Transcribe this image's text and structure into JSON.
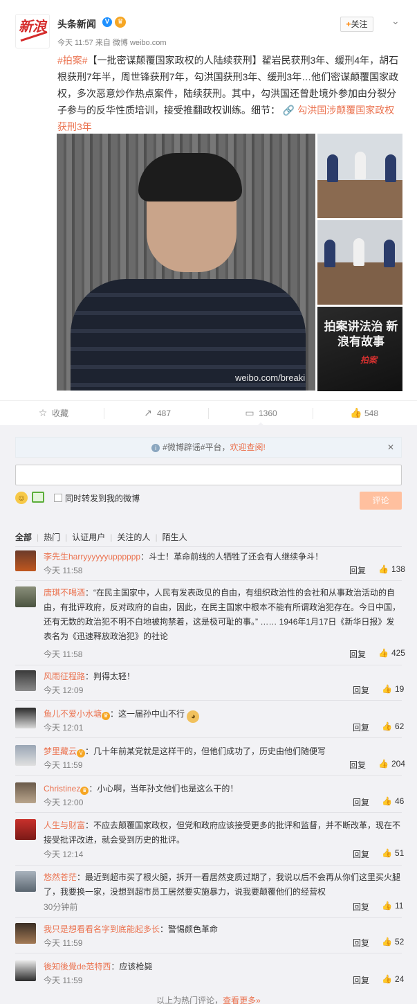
{
  "post": {
    "author": "头条新闻",
    "verified_mark": "V",
    "time": "今天 11:57",
    "source_prefix": "来自",
    "source": "微博 weibo.com",
    "follow_label": "关注",
    "logo_text": "新浪",
    "topic": "#拍案#",
    "body": "【一批密谋颠覆国家政权的人陆续获刑】翟岩民获刑3年、缓刑4年，胡石根获刑7年半，周世锋获刑7年，勾洪国获刑3年、缓刑3年…他们密谋颠覆国家政权，多次恶意炒作热点案件，陆续获刑。其中，勾洪国还曾赴境外参加由分裂分子参与的反华性质培训，接受推翻政权训练。细节：",
    "link_text": "勾洪国涉颠覆国家政权获刑3年",
    "image_watermark": "weibo.com/breaki",
    "side_image_title": "拍案讲法治 新浪有故事",
    "side_image_sign": "拍案"
  },
  "actions": {
    "favorite": "收藏",
    "repost": "487",
    "comment": "1360",
    "like": "548"
  },
  "comments_area": {
    "notice_topic": "#微博辟谣#平台，",
    "notice_welcome": "欢迎查阅!",
    "input_value": "",
    "forward_label": "同时转发到我的微博",
    "submit_label": "评论",
    "filters": [
      "全部",
      "热门",
      "认证用户",
      "关注的人",
      "陌生人"
    ],
    "reply_label": "回复",
    "footer_text": "以上为热门评论，",
    "footer_more": "查看更多»"
  },
  "comments": [
    {
      "user": "李先生harryyyyyyupppppp",
      "text": "：斗士！革命前线的人牺牲了还会有人继续争斗！",
      "time": "今天 11:58",
      "likes": "138"
    },
    {
      "user": "唐琪不喝酒",
      "text": "：“在民主国家中，人民有发表政见的自由，有组织政治性的会社和从事政治活动的自由，有批评政府，反对政府的自由，因此，在民主国家中根本不能有所谓政治犯存在。今日中国，还有无数的政治犯不明不白地被拘禁着，这是极可耻的事。” …… 1946年1月17日《新华日报》发表名为《迅速释放政治犯》的社论",
      "time": "今天 11:58",
      "likes": "425"
    },
    {
      "user": "风雨征程路",
      "text": "：判得太轻！",
      "time": "今天 12:09",
      "likes": "19"
    },
    {
      "user": "鱼儿不爱小水塘",
      "text": "：这一届孙中山不行",
      "time": "今天 12:01",
      "likes": "62"
    },
    {
      "user": "梦里藏云",
      "text": "：几十年前某党就是这样干的，但他们成功了，历史由他们随便写",
      "time": "今天 11:59",
      "likes": "204"
    },
    {
      "user": "Christinez",
      "text": "：小心啊，当年孙文他们也是这么干的！",
      "time": "今天 12:00",
      "likes": "46"
    },
    {
      "user": "人生与财富",
      "text": "：不应去颠覆国家政权，但党和政府应该接受更多的批评和监督，并不断改革，现在不接受批评改进，就会受到历史的批评。",
      "time": "今天 12:14",
      "likes": "51"
    },
    {
      "user": "悠然苍茫",
      "text": "：最近到超市买了根火腿，拆开一看居然变质过期了，我说以后不会再从你们这里买火腿了，我要换一家，没想到超市员工居然要实施暴力，说我要颠覆他们的经营权",
      "time": "30分钟前",
      "likes": "11"
    },
    {
      "user": "我只是想看看名字到底能起多长",
      "text": "：警惕颜色革命",
      "time": "今天 11:59",
      "likes": "52"
    },
    {
      "user": "後知後覺de范特西",
      "text": "：应该枪毙",
      "time": "今天 11:59",
      "likes": "24"
    }
  ]
}
